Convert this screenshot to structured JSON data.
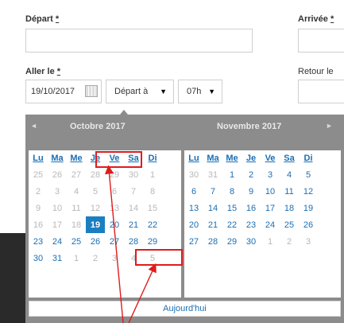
{
  "form": {
    "depart_label": "Départ",
    "arrivee_label": "Arrivée",
    "required_mark": "*",
    "aller_label": "Aller le",
    "retour_label": "Retour le",
    "date_value": "19/10/2017",
    "time_mode_value": "Départ à",
    "hour_value": "07h"
  },
  "calendar": {
    "months": [
      {
        "name": "Octobre 2017"
      },
      {
        "name": "Novembre 2017"
      }
    ],
    "weekdays": [
      "Lu",
      "Ma",
      "Me",
      "Je",
      "Ve",
      "Sa",
      "Di"
    ],
    "october": [
      [
        "25",
        "26",
        "27",
        "28",
        "29",
        "30",
        "1"
      ],
      [
        "2",
        "3",
        "4",
        "5",
        "6",
        "7",
        "8"
      ],
      [
        "9",
        "10",
        "11",
        "12",
        "13",
        "14",
        "15"
      ],
      [
        "16",
        "17",
        "18",
        "19",
        "20",
        "21",
        "22"
      ],
      [
        "23",
        "24",
        "25",
        "26",
        "27",
        "28",
        "29"
      ],
      [
        "30",
        "31",
        "1",
        "2",
        "3",
        "4",
        "5"
      ]
    ],
    "november": [
      [
        "30",
        "31",
        "1",
        "2",
        "3",
        "4",
        "5"
      ],
      [
        "6",
        "7",
        "8",
        "9",
        "10",
        "11",
        "12"
      ],
      [
        "13",
        "14",
        "15",
        "16",
        "17",
        "18",
        "19"
      ],
      [
        "20",
        "21",
        "22",
        "23",
        "24",
        "25",
        "26"
      ],
      [
        "27",
        "28",
        "29",
        "30",
        "1",
        "2",
        "3"
      ]
    ],
    "today_label": "Aujourd'hui",
    "prev_icon": "chevron-left-icon",
    "next_icon": "chevron-right-icon"
  },
  "colors": {
    "accent": "#1a7fc1",
    "highlight": "#e01b1b",
    "popup_bg": "#8c8c8c"
  }
}
